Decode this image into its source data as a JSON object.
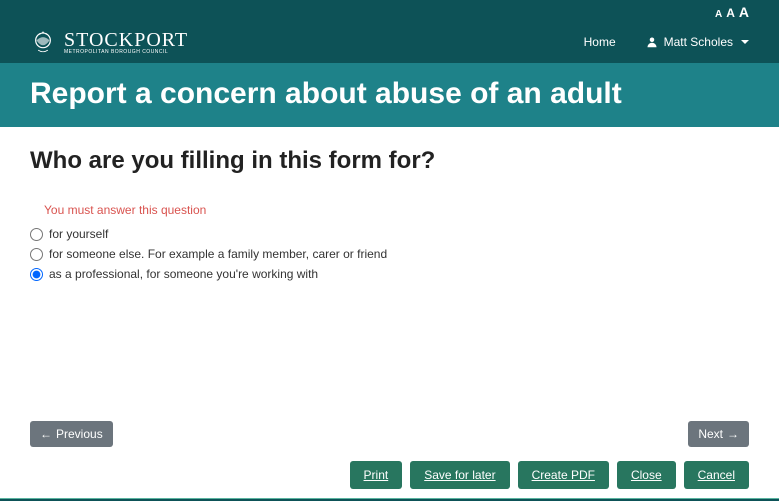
{
  "brand": {
    "name": "STOCKPORT",
    "sub": "METROPOLITAN BOROUGH COUNCIL"
  },
  "nav": {
    "home": "Home",
    "user": "Matt Scholes"
  },
  "page": {
    "title": "Report a concern about abuse of an adult"
  },
  "form": {
    "question": "Who are you filling in this form for?",
    "error": "You must answer this question",
    "options": [
      {
        "label": "for yourself",
        "checked": false
      },
      {
        "label": "for someone else. For example a family member, carer or friend",
        "checked": false
      },
      {
        "label": "as a professional, for someone you're working with",
        "checked": true
      }
    ]
  },
  "buttons": {
    "previous": "Previous",
    "next": "Next",
    "print": "Print",
    "save": "Save for later",
    "pdf": "Create PDF",
    "close": "Close",
    "cancel": "Cancel"
  }
}
